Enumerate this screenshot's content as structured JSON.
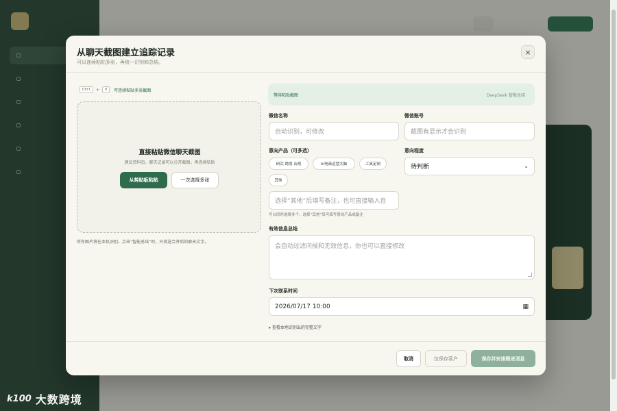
{
  "modal": {
    "title": "从聊天截图建立追踪记录",
    "subtitle": "可以连续粘贴多张，再统一识别和总结。",
    "close_icon": "×",
    "hint": {
      "key1": "Ctrl",
      "plus": "+",
      "key2": "V",
      "text": "可连续粘贴多张截图"
    },
    "dropzone": {
      "title": "直接粘贴微信聊天截图",
      "subtitle": "建议资料页、聊天记录可以分开截图，再连续粘贴",
      "paste_button": "从剪贴板粘贴",
      "multi_button": "一次选择多张"
    },
    "dropzone_note": "所有图片将在本机识别。点击“智能总结”时，只发送合并后的聊天文字。",
    "status": {
      "left": "等待粘贴截图",
      "right": "DeepSeek 智能总结"
    },
    "fields": {
      "wechat_name_label": "微信名称",
      "wechat_name_placeholder": "自动识别，可修改",
      "wechat_id_label": "微信账号",
      "wechat_id_placeholder": "截图有显示才会识别",
      "interest_label": "意向产品（可多选）",
      "interest_chips": [
        "研究 跨境 合规",
        "AI电商运营大脑",
        "工具定制",
        "其他"
      ],
      "other_placeholder": "选择“其他”后填写备注，也可直接输入自",
      "interest_note": "可以同时选择多个，选择“其他”后可填写意向产品或备注",
      "level_label": "意向程度",
      "level_value": "待判断",
      "summary_label": "有效信息总结",
      "summary_placeholder": "会自动过滤问候和无效信息，你也可以直接修改",
      "next_time_label": "下次联系时间",
      "next_time_value": "2026/07/17  10:00",
      "details_toggle": "▸ 查看本地识别出的完整文字"
    },
    "footer": {
      "cancel": "取消",
      "save_only": "仅保存客户",
      "save_next": "保存并安排跟进消息"
    }
  },
  "watermark": {
    "mark": "k100",
    "text": "大数跨境"
  },
  "icons": {
    "close": "close-icon",
    "calendar": "calendar-icon",
    "caret": "chevron-down-icon"
  },
  "colors": {
    "primary": "#2f6c4c",
    "primary_disabled": "#8fb19b",
    "sidebar": "#2c4636"
  }
}
